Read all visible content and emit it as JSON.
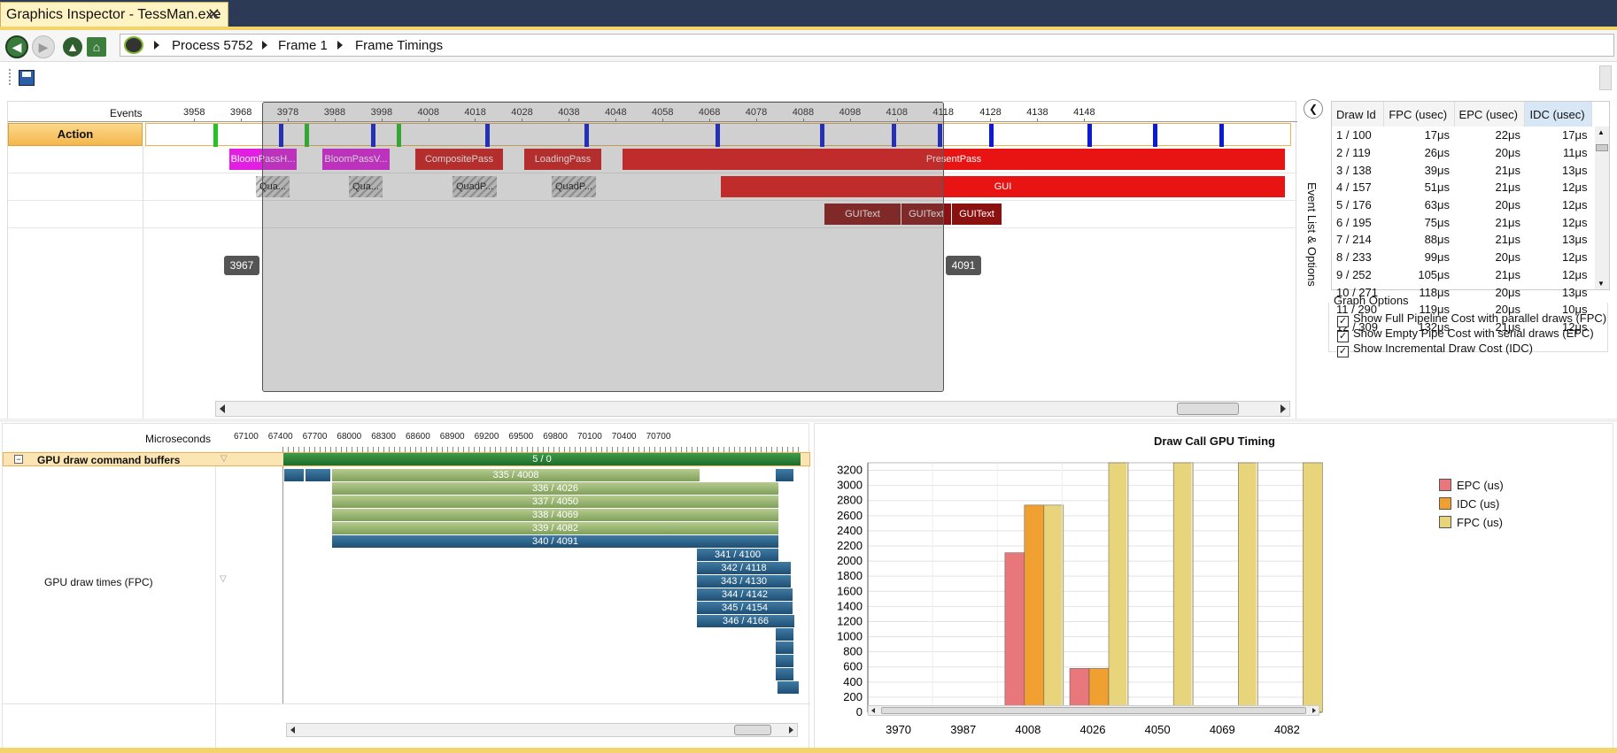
{
  "window": {
    "tab_title": "Graphics Inspector - TessMan.exe",
    "close": "✕"
  },
  "nav": {
    "crumbs": [
      "Process 5752",
      "Frame 1",
      "Frame Timings"
    ]
  },
  "events": {
    "header": "Events",
    "action_label": "Action",
    "ticks": [
      "3958",
      "3968",
      "3978",
      "3988",
      "3998",
      "4008",
      "4018",
      "4028",
      "4038",
      "4048",
      "4058",
      "4068",
      "4078",
      "4088",
      "4098",
      "4108",
      "4118",
      "4128",
      "4138",
      "4148"
    ],
    "passes": [
      "BloomPassH...",
      "BloomPassV...",
      "CompositePass",
      "LoadingPass",
      "PresentPass"
    ],
    "gui": "GUI",
    "quads": [
      "Qua...",
      "Qua...",
      "QuadP...",
      "QuadP..."
    ],
    "guitext": [
      "GUIText",
      "GUIText",
      "GUIText"
    ],
    "marker_left": "3967",
    "marker_right": "4091"
  },
  "side_tab": "Event List & Options",
  "table": {
    "headers": [
      "Draw Id",
      "FPC (usec)",
      "EPC (usec)",
      "IDC (usec)"
    ],
    "rows": [
      [
        "1 / 100",
        "17μs",
        "22μs",
        "17μs"
      ],
      [
        "2 / 119",
        "26μs",
        "20μs",
        "11μs"
      ],
      [
        "3 / 138",
        "39μs",
        "21μs",
        "13μs"
      ],
      [
        "4 / 157",
        "51μs",
        "21μs",
        "12μs"
      ],
      [
        "5 / 176",
        "63μs",
        "20μs",
        "12μs"
      ],
      [
        "6 / 195",
        "75μs",
        "21μs",
        "12μs"
      ],
      [
        "7 / 214",
        "88μs",
        "21μs",
        "13μs"
      ],
      [
        "8 / 233",
        "99μs",
        "20μs",
        "12μs"
      ],
      [
        "9 / 252",
        "105μs",
        "21μs",
        "12μs"
      ],
      [
        "10 / 271",
        "118μs",
        "20μs",
        "13μs"
      ],
      [
        "11 / 290",
        "119μs",
        "20μs",
        "10μs"
      ],
      [
        "12 / 309",
        "132μs",
        "21μs",
        "12μs"
      ]
    ]
  },
  "graph_options": {
    "title": "Graph Options",
    "items": [
      "Show Full Pipeline Cost with parallel draws (FPC)",
      "Show Empty Pipe Cost with serial draws (EPC)",
      "Show Incremental Draw Cost (IDC)"
    ],
    "checked": [
      true,
      true,
      true
    ]
  },
  "gpu": {
    "header": "Microseconds",
    "ticks": [
      "67100",
      "67400",
      "67700",
      "68000",
      "68300",
      "68600",
      "68900",
      "69200",
      "69500",
      "69800",
      "70100",
      "70400",
      "70700"
    ],
    "buffers_label": "GPU draw command buffers",
    "buffers_value": "5 / 0",
    "draw_label": "GPU draw times (FPC)",
    "bars": [
      "335 / 4008",
      "336 / 4026",
      "337 / 4050",
      "338 / 4069",
      "339 / 4082",
      "340 / 4091",
      "341 / 4100",
      "342 / 4118",
      "343 / 4130",
      "344 / 4142",
      "345 / 4154",
      "346 / 4166"
    ]
  },
  "chart_data": {
    "type": "bar",
    "title": "Draw Call GPU Timing",
    "categories": [
      "3970",
      "3987",
      "4008",
      "4026",
      "4050",
      "4069",
      "4082"
    ],
    "ylim": [
      0,
      3300
    ],
    "yticks": [
      "0",
      "200",
      "400",
      "600",
      "800",
      "1000",
      "1200",
      "1400",
      "1600",
      "1800",
      "2000",
      "2200",
      "2400",
      "2600",
      "2800",
      "3000",
      "3200"
    ],
    "series": [
      {
        "name": "EPC (us)",
        "color": "#e8777c",
        "values": [
          0,
          0,
          2110,
          580,
          0,
          0,
          0
        ]
      },
      {
        "name": "IDC (us)",
        "color": "#f0a030",
        "values": [
          0,
          0,
          2740,
          580,
          0,
          0,
          0
        ]
      },
      {
        "name": "FPC (us)",
        "color": "#e8d47a",
        "values": [
          0,
          0,
          2740,
          3350,
          3350,
          3350,
          3350
        ]
      }
    ],
    "legend": "right"
  }
}
